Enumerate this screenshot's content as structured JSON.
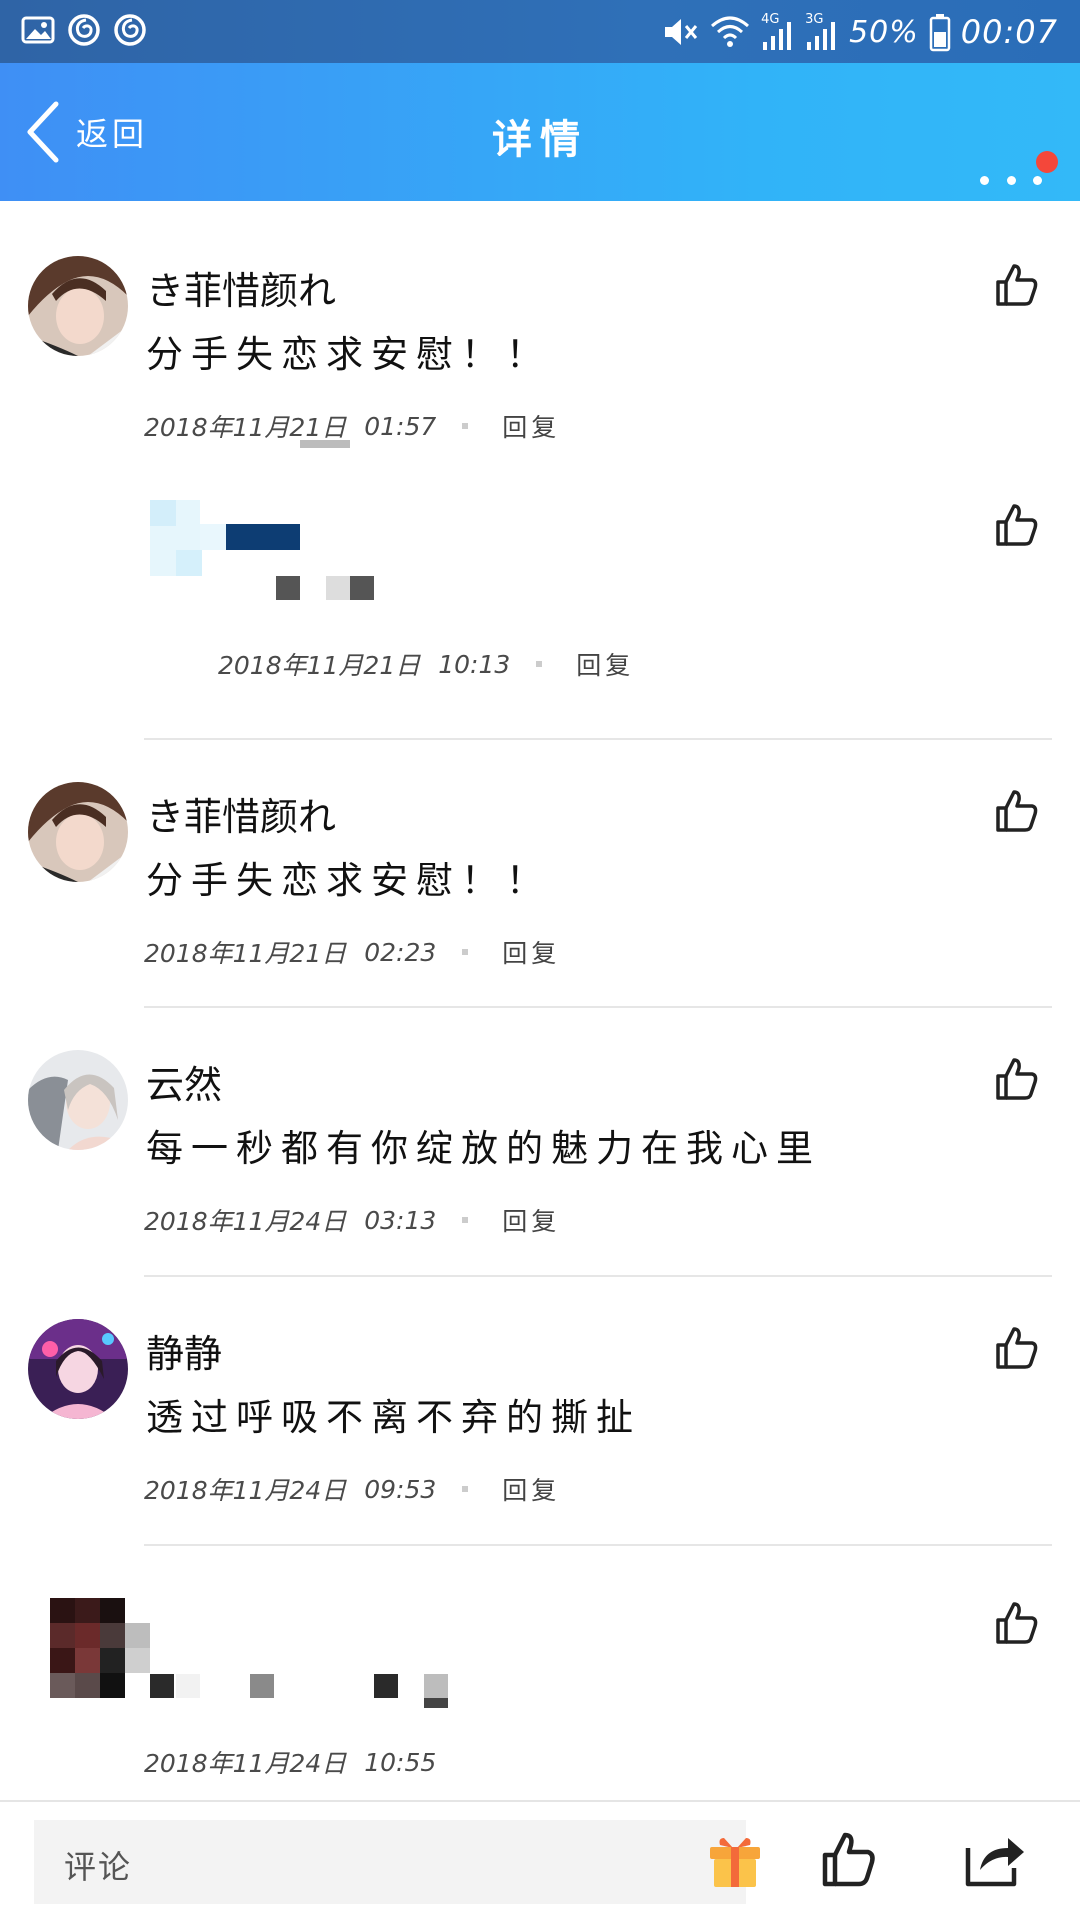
{
  "status_bar": {
    "battery_percent": "50%",
    "time": "00:07",
    "network_labels": [
      "4G",
      "3G"
    ],
    "icons": [
      "image-icon",
      "netease-music-icon",
      "netease-music-icon",
      "mute-icon",
      "wifi-icon",
      "signal-icon",
      "battery-icon"
    ]
  },
  "header": {
    "back_label": "返回",
    "title": "详情",
    "more_icon": "more-dots-icon",
    "badge_color": "#f4473a"
  },
  "comments": [
    {
      "name": "き菲惜颜れ",
      "text": "分手失恋求安慰！！",
      "date": "2018年11月21日",
      "time": "01:57",
      "reply_label": "回复"
    },
    {
      "date": "2018年11月21日",
      "time": "10:13",
      "reply_label": "回复",
      "obscured": true
    },
    {
      "name": "き菲惜颜れ",
      "text": "分手失恋求安慰！！",
      "date": "2018年11月21日",
      "time": "02:23",
      "reply_label": "回复"
    },
    {
      "name": "云然",
      "text": "每一秒都有你绽放的魅力在我心里",
      "date": "2018年11月24日",
      "time": "03:13",
      "reply_label": "回复"
    },
    {
      "name": "静静",
      "text": "透过呼吸不离不弃的撕扯",
      "date": "2018年11月24日",
      "time": "09:53",
      "reply_label": "回复"
    },
    {
      "date": "2018年11月24日",
      "time": "10:55",
      "obscured": true
    }
  ],
  "bottom_bar": {
    "comment_placeholder": "评论",
    "icons": [
      "gift-icon",
      "thumbs-up-icon",
      "share-icon"
    ]
  },
  "colors": {
    "header_gradient_start": "#3f8ff5",
    "header_gradient_end": "#33b9f8",
    "status_bar": "#2f6cb0"
  }
}
